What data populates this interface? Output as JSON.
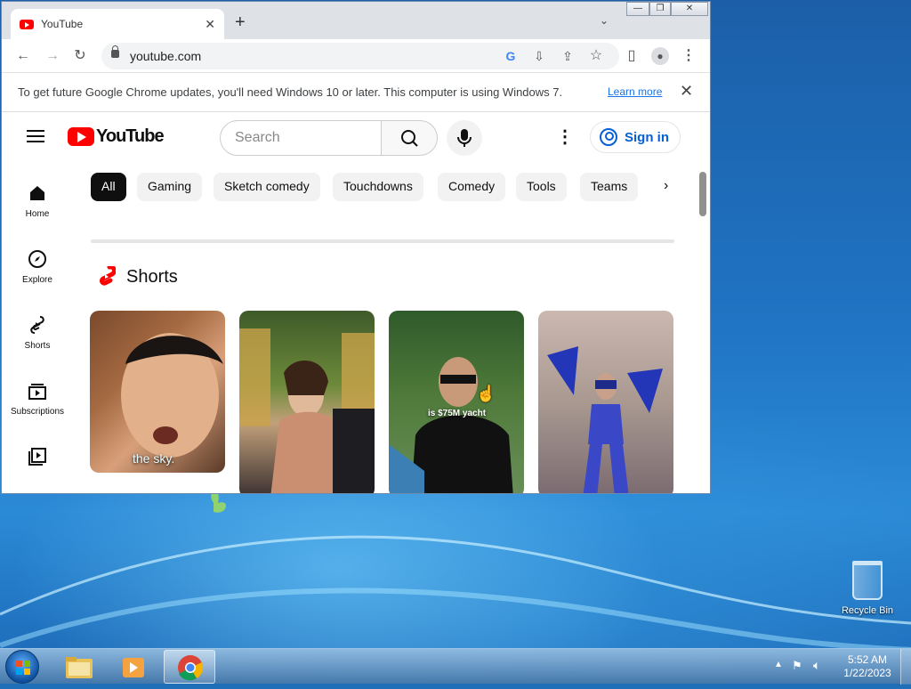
{
  "browser": {
    "tab_title": "YouTube",
    "url": "youtube.com",
    "infobar_message": "To get future Google Chrome updates, you'll need Windows 10 or later. This computer is using Windows 7.",
    "infobar_link": "Learn more"
  },
  "youtube": {
    "logo_text": "YouTube",
    "search_placeholder": "Search",
    "signin_label": "Sign in",
    "sidebar": [
      {
        "label": "Home",
        "icon": "home-icon"
      },
      {
        "label": "Explore",
        "icon": "compass-icon"
      },
      {
        "label": "Shorts",
        "icon": "shorts-icon"
      },
      {
        "label": "Subscriptions",
        "icon": "subscriptions-icon"
      },
      {
        "label": "",
        "icon": "library-icon"
      }
    ],
    "chips": [
      "All",
      "Gaming",
      "Sketch comedy",
      "Touchdowns",
      "Comedy",
      "Tools",
      "Teams"
    ],
    "shorts_title": "Shorts",
    "shorts": [
      {
        "caption": "the sky."
      },
      {
        "caption": ""
      },
      {
        "caption": "is $75M yacht"
      },
      {
        "caption": ""
      }
    ]
  },
  "desktop": {
    "recycle_bin": "Recycle Bin",
    "clock_time": "5:52 AM",
    "clock_date": "1/22/2023"
  }
}
